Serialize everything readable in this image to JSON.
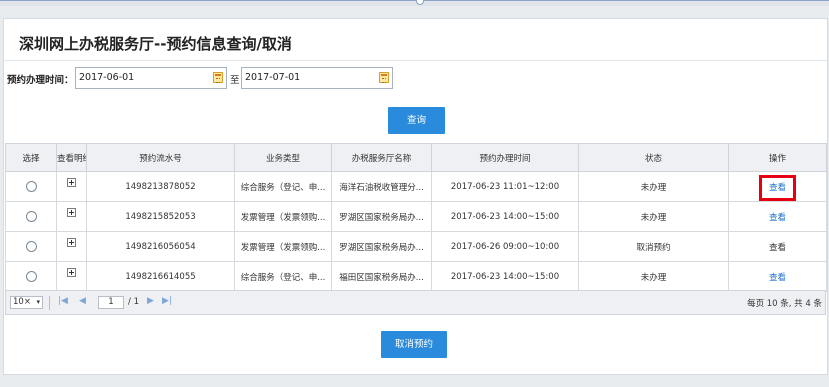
{
  "page_title": "深圳网上办税服务厅--预约信息查询/取消",
  "search": {
    "date_label": "预约办理时间：",
    "from_value": "2017-06-01",
    "to_sep": "至",
    "to_value": "2017-07-01",
    "query_button": "查询"
  },
  "table": {
    "headers": [
      "选择",
      "查看明细",
      "预约流水号",
      "业务类型",
      "办税服务厅名称",
      "预约办理时间",
      "状态",
      "操作"
    ],
    "rows": [
      {
        "serial": "1498213878052",
        "type": "综合服务（登记、申...",
        "hall": "海洋石油税收管理分...",
        "time": "2017-06-23  11:01~12:00",
        "status": "未办理",
        "action": "查看"
      },
      {
        "serial": "1498215852053",
        "type": "发票管理（发票领购...",
        "hall": "罗湖区国家税务局办...",
        "time": "2017-06-23  14:00~15:00",
        "status": "未办理",
        "action": "查看"
      },
      {
        "serial": "1498216056054",
        "type": "发票管理（发票领购...",
        "hall": "罗湖区国家税务局办...",
        "time": "2017-06-26  09:00~10:00",
        "status": "取消预约",
        "action": "查看"
      },
      {
        "serial": "1498216614055",
        "type": "综合服务（登记、申...",
        "hall": "福田区国家税务局办...",
        "time": "2017-06-23  14:00~15:00",
        "status": "未办理",
        "action": "查看"
      }
    ]
  },
  "pager": {
    "page_size": "10",
    "page_size_suffix": "×",
    "current_page": "1",
    "total_pages": "/ 1",
    "info": "每页 10 条, 共 4 条"
  },
  "cancel_button": "取消预约",
  "icons": {
    "first": "|◀",
    "prev": "◀",
    "next": "▶",
    "last": "▶|"
  },
  "colors": {
    "accent": "#2a8bdc",
    "link": "#1a6fc9",
    "highlight": "#e60012"
  }
}
